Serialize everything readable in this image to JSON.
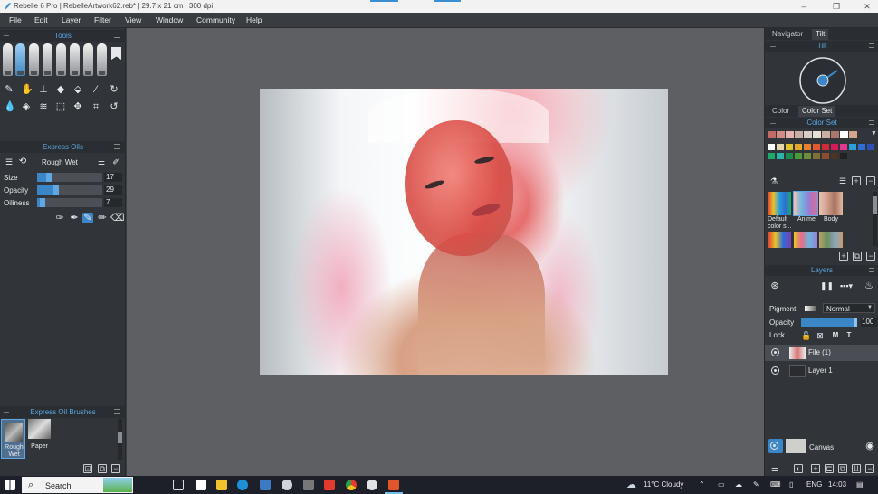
{
  "window": {
    "title": "Rebelle 6 Pro | RebelleArtwork62.reb* | 29.7 x 21 cm | 300 dpi",
    "minimize": "–",
    "maximize": "❐",
    "close": "✕"
  },
  "menu": [
    "File",
    "Edit",
    "Layer",
    "Filter",
    "View",
    "Window",
    "Community",
    "Help"
  ],
  "left": {
    "tools_title": "Tools",
    "oils": {
      "title": "Express Oils",
      "preset": "Rough Wet",
      "size_label": "Size",
      "size": 17,
      "opacity_label": "Opacity",
      "opacity": 29,
      "oiliness_label": "Oiliness",
      "oiliness": 7
    },
    "brushes": {
      "title": "Express Oil Brushes",
      "items": [
        {
          "label": "Rough Wet"
        },
        {
          "label": "Paper"
        }
      ]
    }
  },
  "right": {
    "tabs": [
      "Navigator",
      "Tilt"
    ],
    "tilt_title": "Tilt",
    "color_tabs": [
      "Color",
      "Color Set"
    ],
    "colorset_title": "Color Set",
    "swatches_row1": [
      "#c36b66",
      "#d48a86",
      "#e6b2b0",
      "#c9aea3",
      "#d8cdc3",
      "#e7e0d6",
      "#cbb0a2",
      "#a9776b",
      "#ffffff",
      "#d5a48c"
    ],
    "swatches_row2": [
      "#ffffff",
      "#e7d4a8",
      "#e2c22d",
      "#e6a82a",
      "#e58032",
      "#e0582e",
      "#cf2a3a",
      "#d21d5a",
      "#e1378f",
      "#2aa0d8",
      "#2e6cd6",
      "#2d4fb8"
    ],
    "swatches_row3": [
      "#1aa96b",
      "#2bb5a6",
      "#1e8a4b",
      "#4a9a3a",
      "#6a8f3b",
      "#7f6d3a",
      "#8b4d2e",
      "#4c3326",
      "#222222"
    ],
    "sets": [
      {
        "label": "Default color s..."
      },
      {
        "label": "Anime"
      },
      {
        "label": "Body"
      }
    ],
    "layers": {
      "title": "Layers",
      "pigment_label": "Pigment",
      "blend_mode": "Normal",
      "opacity_label": "Opacity",
      "opacity": 100,
      "lock_label": "Lock",
      "lock_m": "M",
      "lock_t": "T",
      "items": [
        {
          "name": "File (1)"
        },
        {
          "name": "Layer 1"
        }
      ],
      "canvas_label": "Canvas"
    }
  },
  "taskbar": {
    "search_placeholder": "Search",
    "weather": "11°C  Cloudy",
    "lang": "ENG",
    "time": "14:03"
  }
}
